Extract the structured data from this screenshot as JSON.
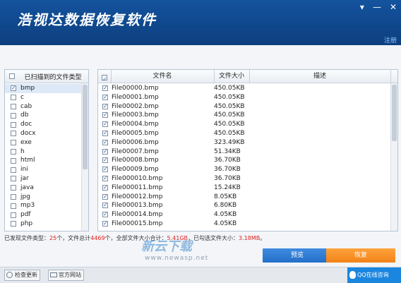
{
  "app": {
    "title": "浩视达数据恢复软件",
    "register": "注册",
    "win_buttons": [
      "▾",
      "—",
      "✕"
    ]
  },
  "left_panel": {
    "header": "已扫描到的文件类型",
    "items": [
      {
        "label": "bmp",
        "checked": true
      },
      {
        "label": "c",
        "checked": false
      },
      {
        "label": "cab",
        "checked": false
      },
      {
        "label": "db",
        "checked": false
      },
      {
        "label": "doc",
        "checked": false
      },
      {
        "label": "docx",
        "checked": false
      },
      {
        "label": "exe",
        "checked": false
      },
      {
        "label": "h",
        "checked": false
      },
      {
        "label": "html",
        "checked": false
      },
      {
        "label": "ini",
        "checked": false
      },
      {
        "label": "jar",
        "checked": false
      },
      {
        "label": "java",
        "checked": false
      },
      {
        "label": "jpg",
        "checked": false
      },
      {
        "label": "mp3",
        "checked": false
      },
      {
        "label": "pdf",
        "checked": false
      },
      {
        "label": "php",
        "checked": false
      }
    ]
  },
  "file_table": {
    "columns": [
      "文件名",
      "文件大小",
      "描述"
    ],
    "rows": [
      {
        "name": "File00000.bmp",
        "size": "450.05KB"
      },
      {
        "name": "File00001.bmp",
        "size": "450.05KB"
      },
      {
        "name": "File00002.bmp",
        "size": "450.05KB"
      },
      {
        "name": "File00003.bmp",
        "size": "450.05KB"
      },
      {
        "name": "File00004.bmp",
        "size": "450.05KB"
      },
      {
        "name": "File00005.bmp",
        "size": "450.05KB"
      },
      {
        "name": "File00006.bmp",
        "size": "323.49KB"
      },
      {
        "name": "File00007.bmp",
        "size": "51.34KB"
      },
      {
        "name": "File00008.bmp",
        "size": "36.70KB"
      },
      {
        "name": "File00009.bmp",
        "size": "36.70KB"
      },
      {
        "name": "File000010.bmp",
        "size": "36.70KB"
      },
      {
        "name": "File000011.bmp",
        "size": "15.24KB"
      },
      {
        "name": "File000012.bmp",
        "size": "8.05KB"
      },
      {
        "name": "File000013.bmp",
        "size": "6.80KB"
      },
      {
        "name": "File000014.bmp",
        "size": "4.05KB"
      },
      {
        "name": "File000015.bmp",
        "size": "4.05KB"
      }
    ]
  },
  "status": {
    "prefix": "已发现文件类型：",
    "types_count": "25",
    "mid": "个，文件总计",
    "files_count": "4469",
    "mid2": "个，全部文件大小合计：",
    "total_size": "5.41GB",
    "mid3": "，已勾选文件大小：",
    "selected_size": "3.18MB",
    "suffix": "。"
  },
  "buttons": {
    "preview": "预览",
    "recover": "恢复"
  },
  "footer": {
    "check_update": "检查更新",
    "official_site": "官方网站",
    "qq": "QQ在线咨询"
  },
  "watermark": {
    "text": "新云下载",
    "url": "www.newasp.net"
  },
  "colors": {
    "header": "#14539e",
    "preview": "#2f7fd8",
    "recover": "#f68f22",
    "highlight": "#e02020"
  }
}
